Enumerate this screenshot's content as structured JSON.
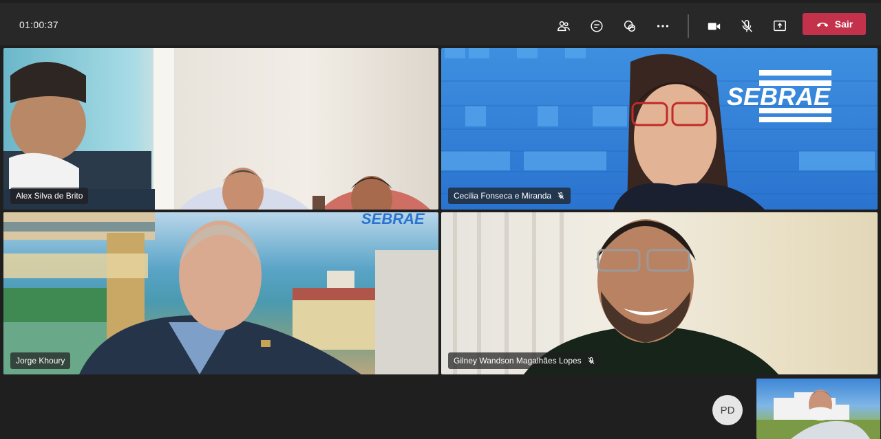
{
  "toolbar": {
    "timer": "01:00:37",
    "icons": [
      "participants-icon",
      "chat-icon",
      "reactions-icon",
      "more-icon",
      "camera-icon",
      "mic-off-icon",
      "share-icon"
    ],
    "leave_label": "Sair",
    "leave_color": "#c4314b"
  },
  "participants": [
    {
      "name": "Alex Silva de Brito",
      "muted": false
    },
    {
      "name": "Cecilia Fonseca e Miranda",
      "muted": true
    },
    {
      "name": "Jorge Khoury",
      "muted": false
    },
    {
      "name": "Gilney Wandson Magalhães Lopes",
      "muted": true
    }
  ],
  "brand": {
    "sebrae": "SEBRAE",
    "color": "#2a73cf"
  },
  "footer": {
    "avatar_initials": "PD"
  }
}
